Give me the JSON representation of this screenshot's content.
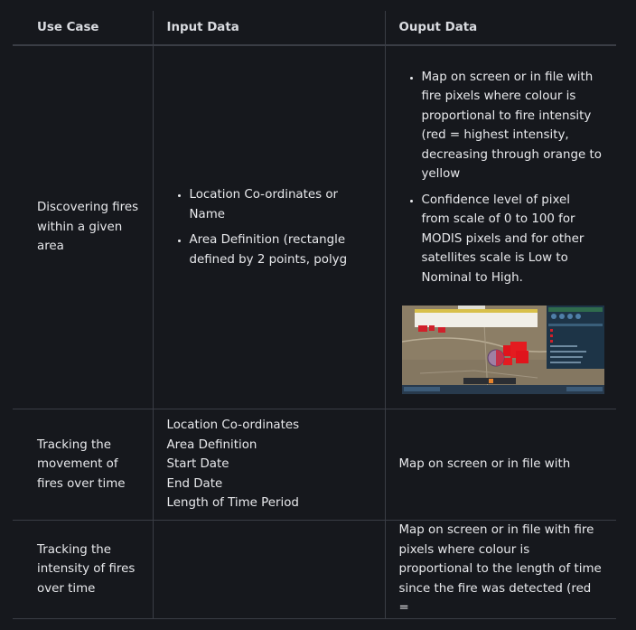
{
  "headers": [
    "Use Case",
    "Input Data",
    "Ouput Data"
  ],
  "rows": [
    {
      "use_case": "Discovering fires within a given area",
      "input_items": [
        "Location Co-ordinates or Name",
        "Area Definition (rectangle defined by 2 points, polyg"
      ],
      "output_items": [
        "Map on screen or in file with fire pixels where colour is proportional to fire intensity (red = highest intensity, decreasing through orange to yellow",
        "Confidence level of pixel from scale of 0 to 100 for MODIS pixels and for other satellites scale is Low to Nominal to High."
      ],
      "output_image": "fire-map-screenshot"
    },
    {
      "use_case": "Tracking the movement of fires over time",
      "input_lines": [
        "Location Co-ordinates",
        "Area Definition",
        "Start Date",
        "End Date",
        "Length of Time Period"
      ],
      "output_text": "Map on screen or in file with"
    },
    {
      "use_case": "Tracking the intensity of fires over time",
      "input_text": "",
      "output_text": "Map on screen or in file with fire pixels where colour is proportional to the length of time since the fire was detected (red ="
    }
  ]
}
